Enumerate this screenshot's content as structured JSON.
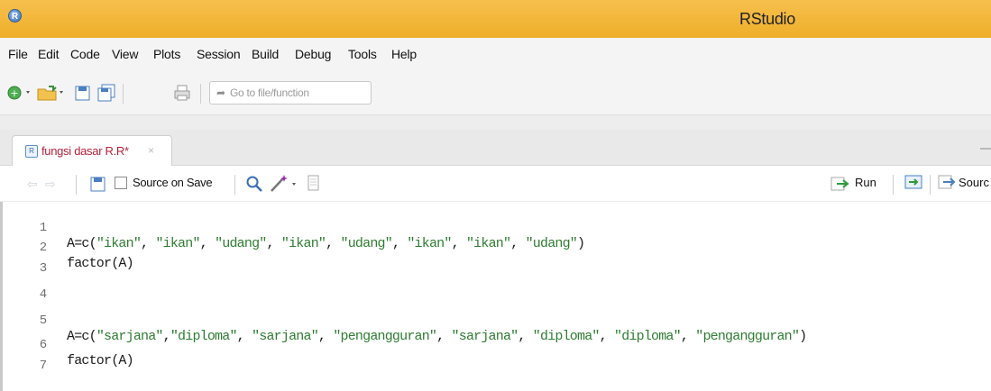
{
  "window": {
    "app_icon": "R",
    "title": "RStudio"
  },
  "menu": [
    "File",
    "Edit",
    "Code",
    "View",
    "Plots",
    "Session",
    "Build",
    "Debug",
    "Tools",
    "Help"
  ],
  "toolbar": {
    "goto_placeholder": "Go to file/function",
    "icons": [
      "new-file-icon",
      "open-folder-icon",
      "save-icon",
      "save-all-icon",
      "print-icon",
      "arrow-icon"
    ]
  },
  "tab": {
    "filename": "fungsi dasar R.R*",
    "close": "×"
  },
  "editor_toolbar": {
    "source_on_save_label": "Source on Save",
    "source_on_save_checked": false,
    "run_label": "Run",
    "source_label": "Sourc"
  },
  "code": {
    "lines": [
      {
        "n": "1",
        "text": "A=c(\"ikan\", \"ikan\", \"udang\", \"ikan\", \"udang\", \"ikan\", \"ikan\", \"udang\")"
      },
      {
        "n": "2",
        "text": "factor(A)"
      },
      {
        "n": "3",
        "text": ""
      },
      {
        "n": "4",
        "text": ""
      },
      {
        "n": "5",
        "text": "A=c(\"sarjana\",\"diploma\", \"sarjana\", \"pengangguran\", \"sarjana\", \"diploma\", \"diploma\", \"pengangguran\")"
      },
      {
        "n": "6",
        "text": "factor(A)"
      },
      {
        "n": "7",
        "text": ""
      }
    ]
  },
  "colors": {
    "titlebar": "#f1b535",
    "tab_label": "#b3223a",
    "string": "#2e7d32"
  }
}
